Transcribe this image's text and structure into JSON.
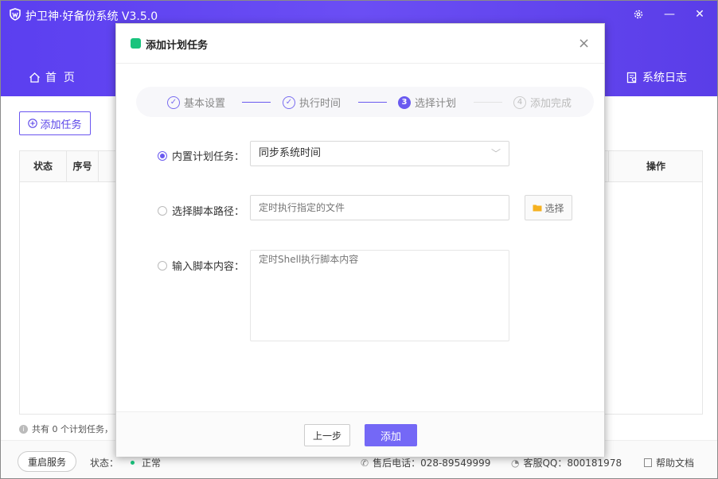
{
  "app": {
    "title": "护卫神·好备份系统  V3.5.0",
    "colors": {
      "accent": "#5b3ff0",
      "primary_button": "#7468f6",
      "done_step": "#6a5af0",
      "status_ok": "#19c37d"
    }
  },
  "window": {
    "settings_icon": "gear-icon",
    "minimize_label": "—",
    "close_label": "✕"
  },
  "nav": {
    "home_label": "首  页",
    "log_label": "系统日志"
  },
  "main": {
    "add_task_label": "添加任务",
    "table_headers": {
      "status": "状态",
      "index": "序号",
      "action": "操作"
    },
    "footer_count": "共有 0 个计划任务，"
  },
  "statusbar": {
    "restart_label": "重启服务",
    "status_label": "状态：",
    "status_value": "正常",
    "phone_label": "售后电话：028-89549999",
    "qq_label": "客服QQ：800181978",
    "help_label": "帮助文档"
  },
  "dialog": {
    "title": "添加计划任务",
    "close_label": "×",
    "steps": [
      {
        "label": "基本设置",
        "number": "✓",
        "state": "done"
      },
      {
        "label": "执行时间",
        "number": "✓",
        "state": "done"
      },
      {
        "label": "选择计划",
        "number": "3",
        "state": "active"
      },
      {
        "label": "添加完成",
        "number": "4",
        "state": "pending"
      }
    ],
    "builtin": {
      "label": "内置计划任务：",
      "value": "同步系统时间",
      "selected": true
    },
    "script_path": {
      "label": "选择脚本路径：",
      "placeholder": "定时执行指定的文件",
      "choose_label": "选择"
    },
    "script_content": {
      "label": "输入脚本内容：",
      "placeholder": "定时Shell执行脚本内容"
    },
    "prev_label": "上一步",
    "submit_label": "添加"
  }
}
